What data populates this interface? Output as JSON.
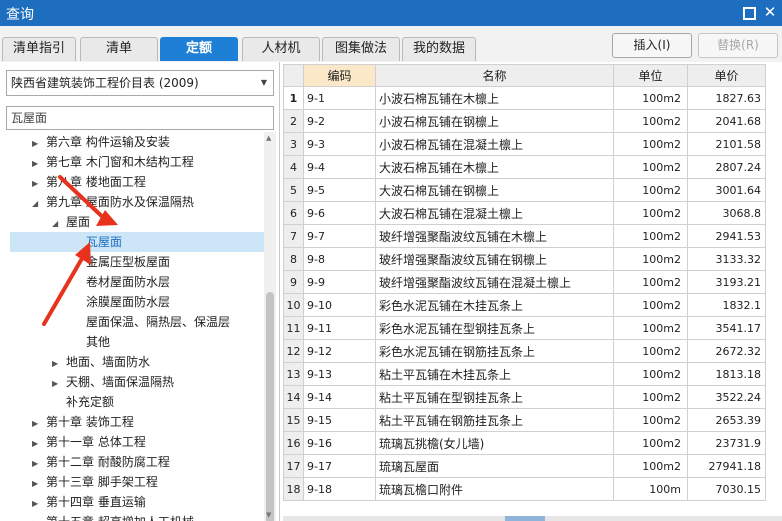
{
  "window": {
    "title": "查询"
  },
  "tabs": [
    {
      "label": "清单指引",
      "active": false
    },
    {
      "label": "清单",
      "active": false
    },
    {
      "label": "定额",
      "active": true
    },
    {
      "label": "人材机",
      "active": false
    },
    {
      "label": "图集做法",
      "active": false
    },
    {
      "label": "我的数据",
      "active": false
    }
  ],
  "actions": {
    "insert": "插入(I)",
    "replace": "替换(R)"
  },
  "left": {
    "catalog": "陕西省建筑装饰工程价目表 (2009)",
    "search": "瓦屋面",
    "tree": [
      {
        "label": "第六章  构件运输及安装",
        "level": 0,
        "toggle": "collapsed",
        "selected": false
      },
      {
        "label": "第七章  木门窗和木结构工程",
        "level": 0,
        "toggle": "collapsed",
        "selected": false
      },
      {
        "label": "第八章  楼地面工程",
        "level": 0,
        "toggle": "collapsed",
        "selected": false
      },
      {
        "label": "第九章  屋面防水及保温隔热",
        "level": 0,
        "toggle": "expanded",
        "selected": false
      },
      {
        "label": "屋面",
        "level": 1,
        "toggle": "expanded",
        "selected": false
      },
      {
        "label": "瓦屋面",
        "level": 2,
        "toggle": "none",
        "selected": true
      },
      {
        "label": "金属压型板屋面",
        "level": 2,
        "toggle": "none",
        "selected": false
      },
      {
        "label": "卷材屋面防水层",
        "level": 2,
        "toggle": "none",
        "selected": false
      },
      {
        "label": "涂膜屋面防水层",
        "level": 2,
        "toggle": "none",
        "selected": false
      },
      {
        "label": "屋面保温、隔热层、保温层",
        "level": 2,
        "toggle": "none",
        "selected": false
      },
      {
        "label": "其他",
        "level": 2,
        "toggle": "none",
        "selected": false
      },
      {
        "label": "地面、墙面防水",
        "level": 1,
        "toggle": "collapsed",
        "selected": false
      },
      {
        "label": "天棚、墙面保温隔热",
        "level": 1,
        "toggle": "collapsed",
        "selected": false
      },
      {
        "label": "补充定额",
        "level": 1,
        "toggle": "none",
        "selected": false
      },
      {
        "label": "第十章  装饰工程",
        "level": 0,
        "toggle": "collapsed",
        "selected": false
      },
      {
        "label": "第十一章  总体工程",
        "level": 0,
        "toggle": "collapsed",
        "selected": false
      },
      {
        "label": "第十二章  耐酸防腐工程",
        "level": 0,
        "toggle": "collapsed",
        "selected": false
      },
      {
        "label": "第十三章  脚手架工程",
        "level": 0,
        "toggle": "collapsed",
        "selected": false
      },
      {
        "label": "第十四章  垂直运输",
        "level": 0,
        "toggle": "collapsed",
        "selected": false
      },
      {
        "label": "第十五章  超高增加人工机械",
        "level": 0,
        "toggle": "collapsed",
        "selected": false
      }
    ]
  },
  "table": {
    "headers": [
      "编码",
      "名称",
      "单位",
      "单价"
    ],
    "rows": [
      {
        "n": "1",
        "code": "9-1",
        "name": "小波石棉瓦铺在木檩上",
        "unit": "100m2",
        "price": "1827.63"
      },
      {
        "n": "2",
        "code": "9-2",
        "name": "小波石棉瓦铺在钢檩上",
        "unit": "100m2",
        "price": "2041.68"
      },
      {
        "n": "3",
        "code": "9-3",
        "name": "小波石棉瓦铺在混凝土檩上",
        "unit": "100m2",
        "price": "2101.58"
      },
      {
        "n": "4",
        "code": "9-4",
        "name": "大波石棉瓦铺在木檩上",
        "unit": "100m2",
        "price": "2807.24"
      },
      {
        "n": "5",
        "code": "9-5",
        "name": "大波石棉瓦铺在钢檩上",
        "unit": "100m2",
        "price": "3001.64"
      },
      {
        "n": "6",
        "code": "9-6",
        "name": "大波石棉瓦铺在混凝土檩上",
        "unit": "100m2",
        "price": "3068.8"
      },
      {
        "n": "7",
        "code": "9-7",
        "name": "玻纤增强聚酯波纹瓦铺在木檩上",
        "unit": "100m2",
        "price": "2941.53"
      },
      {
        "n": "8",
        "code": "9-8",
        "name": "玻纤增强聚酯波纹瓦铺在钢檩上",
        "unit": "100m2",
        "price": "3133.32"
      },
      {
        "n": "9",
        "code": "9-9",
        "name": "玻纤增强聚酯波纹瓦铺在混凝土檩上",
        "unit": "100m2",
        "price": "3193.21"
      },
      {
        "n": "10",
        "code": "9-10",
        "name": "彩色水泥瓦铺在木挂瓦条上",
        "unit": "100m2",
        "price": "1832.1"
      },
      {
        "n": "11",
        "code": "9-11",
        "name": "彩色水泥瓦铺在型钢挂瓦条上",
        "unit": "100m2",
        "price": "3541.17"
      },
      {
        "n": "12",
        "code": "9-12",
        "name": "彩色水泥瓦铺在钢筋挂瓦条上",
        "unit": "100m2",
        "price": "2672.32"
      },
      {
        "n": "13",
        "code": "9-13",
        "name": "粘土平瓦铺在木挂瓦条上",
        "unit": "100m2",
        "price": "1813.18"
      },
      {
        "n": "14",
        "code": "9-14",
        "name": "粘土平瓦铺在型钢挂瓦条上",
        "unit": "100m2",
        "price": "3522.24"
      },
      {
        "n": "15",
        "code": "9-15",
        "name": "粘土平瓦铺在钢筋挂瓦条上",
        "unit": "100m2",
        "price": "2653.39"
      },
      {
        "n": "16",
        "code": "9-16",
        "name": "琉璃瓦挑檐(女儿墙)",
        "unit": "100m2",
        "price": "23731.9"
      },
      {
        "n": "17",
        "code": "9-17",
        "name": "琉璃瓦屋面",
        "unit": "100m2",
        "price": "27941.18"
      },
      {
        "n": "18",
        "code": "9-18",
        "name": "琉璃瓦檐口附件",
        "unit": "100m",
        "price": "7030.15"
      }
    ]
  },
  "colors": {
    "accent": "#1e7fd6",
    "arrow": "#e8321e",
    "selection": "#cce6f8"
  }
}
